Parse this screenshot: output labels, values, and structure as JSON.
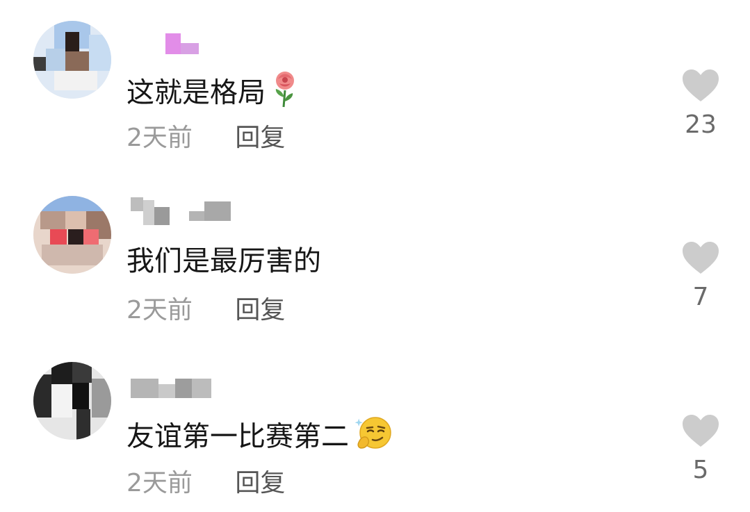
{
  "comments": [
    {
      "text": "这就是格局",
      "emoji": "rose-icon",
      "time": "2天前",
      "reply_label": "回复",
      "like_icon": "heart-icon",
      "likes": "23"
    },
    {
      "text": "我们是最厉害的",
      "emoji": "",
      "time": "2天前",
      "reply_label": "回复",
      "like_icon": "heart-icon",
      "likes": "7"
    },
    {
      "text": "友谊第一比赛第二",
      "emoji": "smirk-thinking-face-icon",
      "time": "2天前",
      "reply_label": "回复",
      "like_icon": "heart-icon",
      "likes": "5"
    }
  ],
  "colors": {
    "text": "#161616",
    "meta": "#9a9a9a",
    "heart": "#cccccc",
    "count": "#6a6a6a"
  }
}
